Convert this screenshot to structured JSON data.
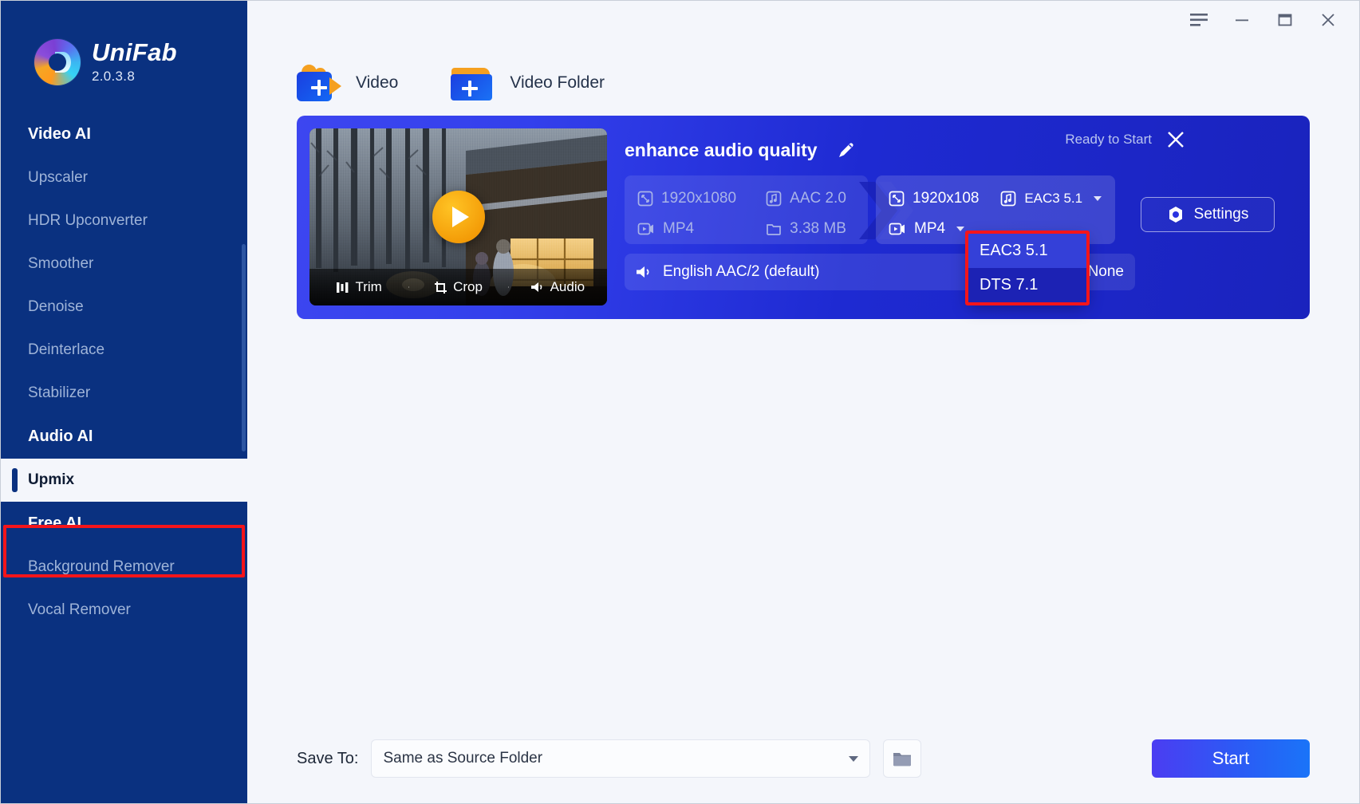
{
  "app": {
    "name": "UniFab",
    "version": "2.0.3.8"
  },
  "titlebar": {
    "menu_icon": "hamburger-menu-icon",
    "minimize_icon": "minimize-icon",
    "maximize_icon": "maximize-icon",
    "close_icon": "close-icon"
  },
  "sidebar": {
    "groups": [
      {
        "label": "Video AI"
      },
      {
        "label": "Audio AI"
      },
      {
        "label": "Free AI"
      }
    ],
    "items": [
      {
        "label": "Upscaler",
        "active": false
      },
      {
        "label": "HDR Upconverter",
        "active": false
      },
      {
        "label": "Smoother",
        "active": false
      },
      {
        "label": "Denoise",
        "active": false
      },
      {
        "label": "Deinterlace",
        "active": false
      },
      {
        "label": "Stabilizer",
        "active": false
      },
      {
        "label": "Upmix",
        "active": true
      },
      {
        "label": "Background Remover",
        "active": false
      },
      {
        "label": "Vocal Remover",
        "active": false
      }
    ]
  },
  "addbar": {
    "video_label": "Video",
    "video_folder_label": "Video Folder"
  },
  "task": {
    "title": "enhance audio quality",
    "status": "Ready to Start",
    "edit_icon": "pencil-icon",
    "close_icon": "close-icon",
    "thumbnail_tools": [
      {
        "label": "Trim",
        "icon": "trim-icon"
      },
      {
        "label": "Crop",
        "icon": "crop-icon"
      },
      {
        "label": "Audio",
        "icon": "speaker-icon"
      }
    ],
    "source": {
      "resolution": "1920x1080",
      "audio_codec": "AAC 2.0",
      "format": "MP4",
      "size": "3.38 MB"
    },
    "target": {
      "resolution": "1920x108",
      "audio_codec": "EAC3 5.1",
      "format": "MP4"
    },
    "audio_track": "English AAC/2 (default)",
    "subtitle_track": "None",
    "settings_label": "Settings",
    "settings_icon": "gear-icon"
  },
  "dropdown": {
    "open": true,
    "options": [
      {
        "label": "EAC3 5.1",
        "selected": true
      },
      {
        "label": "DTS 7.1",
        "selected": false
      }
    ]
  },
  "bottom": {
    "save_to_label": "Save To:",
    "save_to_value": "Same as Source Folder",
    "browse_icon": "folder-icon",
    "start_label": "Start"
  },
  "colors": {
    "sidebar_bg": "#0a3180",
    "accent_red": "#f5151a",
    "card_blue": "#2b34e0",
    "start_gradient_from": "#4b3df2",
    "start_gradient_to": "#1a74f8",
    "orange": "#f5a020"
  }
}
